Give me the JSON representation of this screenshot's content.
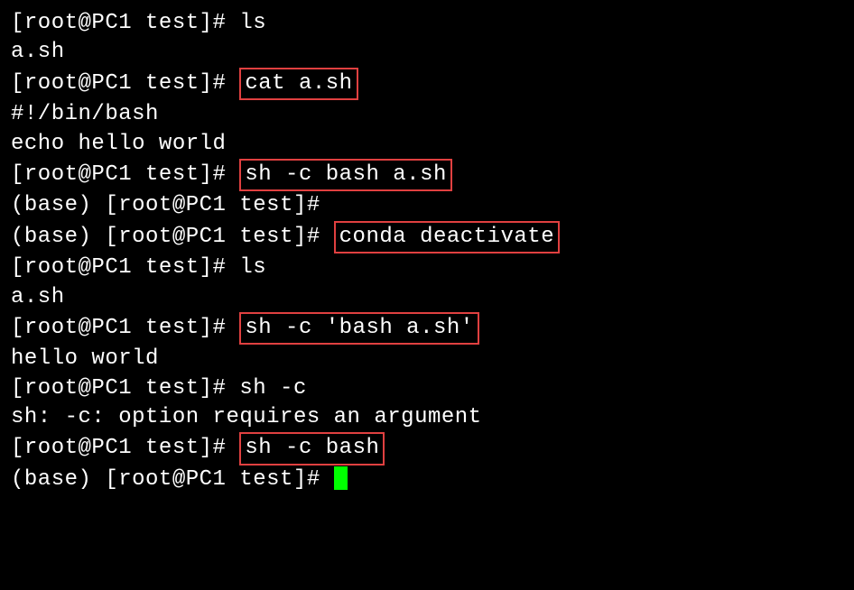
{
  "lines": [
    {
      "prompt": "[root@PC1 test]# ",
      "cmd": "ls",
      "box": false
    },
    {
      "output": "a.sh"
    },
    {
      "prompt": "[root@PC1 test]# ",
      "cmd": "cat a.sh",
      "box": true
    },
    {
      "output": "#!/bin/bash"
    },
    {
      "output": "echo hello world"
    },
    {
      "prompt": "[root@PC1 test]# ",
      "cmd": "sh -c bash a.sh",
      "box": true
    },
    {
      "prompt": "(base) [root@PC1 test]#",
      "cmd": "",
      "box": false
    },
    {
      "prompt": "(base) [root@PC1 test]# ",
      "cmd": "conda deactivate",
      "box": true
    },
    {
      "prompt": "[root@PC1 test]# ",
      "cmd": "ls",
      "box": false
    },
    {
      "output": "a.sh"
    },
    {
      "prompt": "[root@PC1 test]# ",
      "cmd": "sh -c 'bash a.sh'",
      "box": true
    },
    {
      "output": "hello world"
    },
    {
      "prompt": "[root@PC1 test]# ",
      "cmd": "sh -c",
      "box": false
    },
    {
      "output": "sh: -c: option requires an argument"
    },
    {
      "prompt": "[root@PC1 test]# ",
      "cmd": "sh -c bash",
      "box": true
    },
    {
      "prompt": "(base) [root@PC1 test]# ",
      "cmd": "",
      "box": false,
      "cursor": true
    }
  ]
}
